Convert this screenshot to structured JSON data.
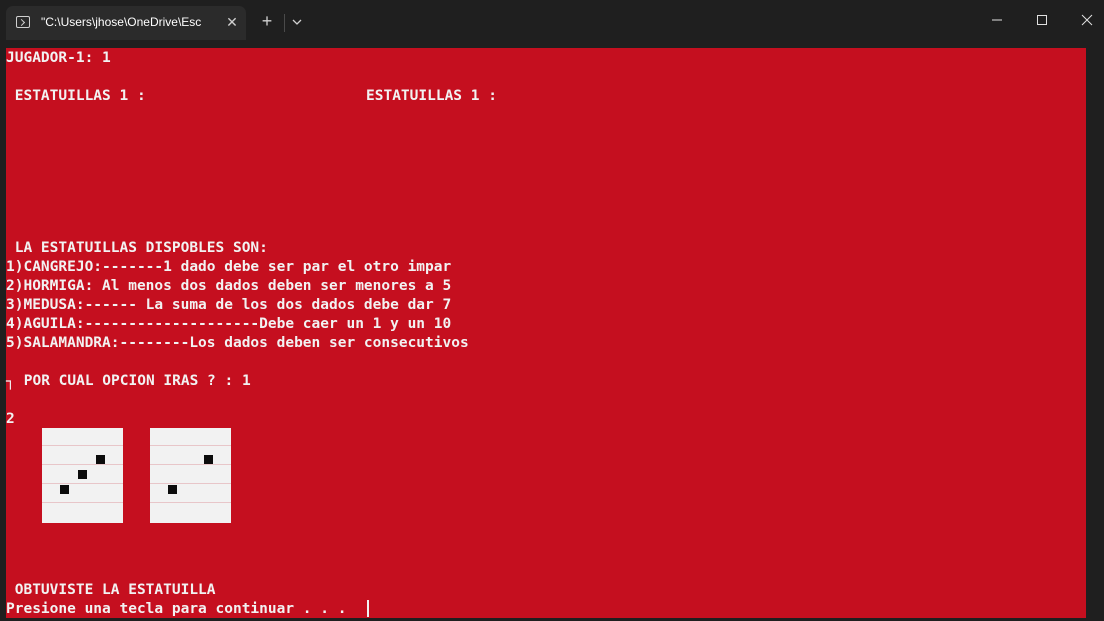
{
  "window": {
    "tab_title": "\"C:\\Users\\jhose\\OneDrive\\Esc",
    "tab_close_glyph": "✕",
    "new_tab_glyph": "+",
    "icons": [
      "terminal-icon",
      "close-icon",
      "plus-icon",
      "chevron-down-icon",
      "minimize-icon",
      "maximize-icon",
      "window-close-icon"
    ]
  },
  "colors": {
    "console_background": "#c50f1f",
    "console_text": "#f2f2f2",
    "dice_face": "#f2f2f2",
    "dice_pip": "#0c0c0c"
  },
  "console": {
    "player": "JUGADOR-1: 1",
    "statues_left": " ESTATUILLAS 1 :",
    "statues_right": "ESTATUILLAS 1 :",
    "available_heading": " LA ESTATUILLAS DISPOBLES SON:",
    "options": [
      "1)CANGREJO:-------1 dado debe ser par el otro impar",
      "2)HORMIGA: Al menos dos dados deben ser menores a 5",
      "3)MEDUSA:------ La suma de los dos dados debe dar 7",
      "4)AGUILA:--------------------Debe caer un 1 y un 10",
      "5)SALAMANDRA:--------Los dados deben ser consecutivos"
    ],
    "prompt_marker": "┐",
    "prompt": " POR CUAL OPCION IRAS ? : 1",
    "roll_marker": "2",
    "dice_values": [
      3,
      2
    ],
    "result": " OBTUVISTE LA ESTATUILLA",
    "continue_prompt": "Presione una tecla para continuar . . ."
  }
}
